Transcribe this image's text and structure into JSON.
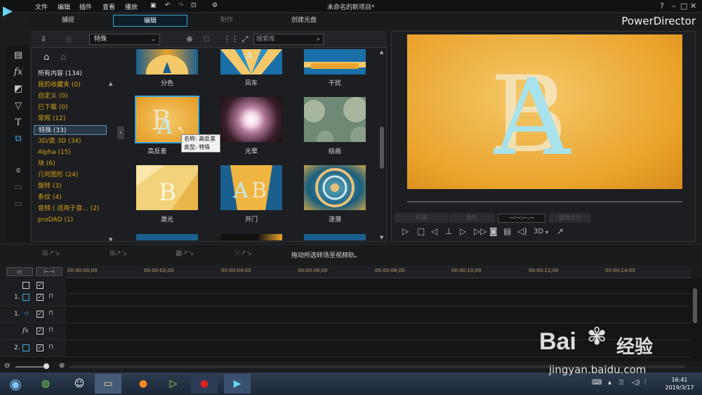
{
  "app": {
    "logo_text": "▶",
    "menus": [
      "文件",
      "编辑",
      "插件",
      "查看",
      "播放"
    ],
    "doc_title": "未命名的新项目*",
    "brand": "PowerDirector"
  },
  "modes": {
    "capture": "捕捉",
    "edit": "编辑",
    "produce": "制作",
    "disc": "创建光盘"
  },
  "library": {
    "category": "特殊",
    "search_placeholder": "搜索库",
    "categories": [
      {
        "label": "所有内容 (134)",
        "style": "white"
      },
      {
        "label": "我的收藏夹 (0)",
        "style": "gold"
      },
      {
        "label": "自定义 (0)",
        "style": "gold"
      },
      {
        "label": "已下载 (0)",
        "style": "gold"
      },
      {
        "label": "常规 (12)",
        "style": "gold"
      },
      {
        "label": "特殊 (33)",
        "style": "sel"
      },
      {
        "label": "3D/类 3D (34)",
        "style": "gold"
      },
      {
        "label": "Alpha (15)",
        "style": "gold"
      },
      {
        "label": "块 (6)",
        "style": "gold"
      },
      {
        "label": "几何图形 (24)",
        "style": "gold"
      },
      {
        "label": "旋转 (3)",
        "style": "gold"
      },
      {
        "label": "条纹 (4)",
        "style": "gold"
      },
      {
        "label": "音频 ( 适用于音... (2)",
        "style": "gold"
      },
      {
        "label": "proDAD (1)",
        "style": "gold"
      }
    ],
    "thumbnails": [
      {
        "label": "分色"
      },
      {
        "label": "风车"
      },
      {
        "label": "干扰"
      },
      {
        "label": "高反差"
      },
      {
        "label": "光晕"
      },
      {
        "label": "绘画"
      },
      {
        "label": "激光"
      },
      {
        "label": "开门"
      },
      {
        "label": "涟漪"
      }
    ],
    "tooltip": {
      "name": "名称: 高反差",
      "type": "类型: 特殊"
    }
  },
  "preview": {
    "timecode": "--:--:--.--",
    "btn_clip": "片段",
    "btn_all": "全片",
    "btn_size": "适合大小",
    "btn_3d": "3D"
  },
  "timeline": {
    "hint": "拖动所选转场至视频轨。",
    "ticks": [
      "00:00:00;00",
      "00:00:02;00",
      "00:00:04;00",
      "00:00:06;00",
      "00:00:08;00",
      "00:00:10;00",
      "00:00:12;00",
      "00:00:14;00"
    ],
    "tracks": [
      {
        "label": ""
      },
      {
        "label": "1."
      },
      {
        "label": "1."
      },
      {
        "label": "fx"
      },
      {
        "label": "2."
      }
    ]
  },
  "taskbar": {
    "time": "16:41",
    "date": "2019/3/17"
  },
  "watermark": {
    "brand": "Bai",
    "brand_cn": "经验",
    "url": "jingyan.baidu.com"
  },
  "colors": {
    "accent": "#3aa7d8",
    "category_gold": "#d4a017",
    "preview_orange": "#eaa32c"
  }
}
